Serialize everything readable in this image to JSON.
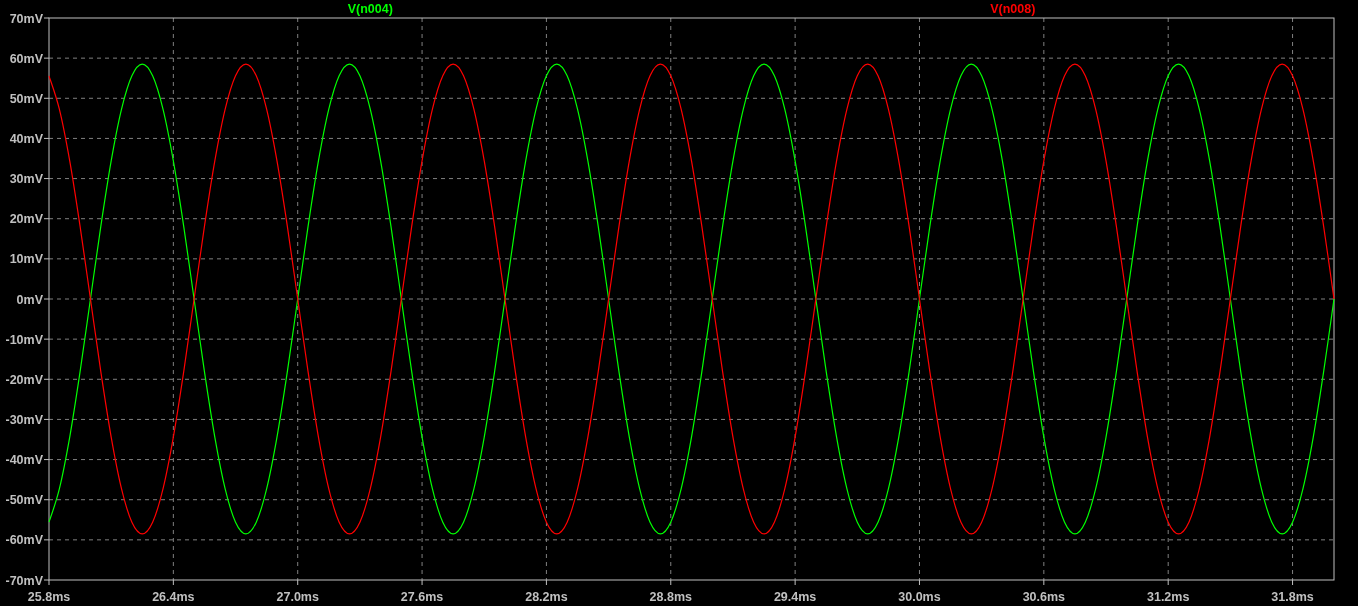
{
  "plot": {
    "chart_data": {
      "type": "line",
      "grid": true,
      "xlim": [
        25.8,
        32.0
      ],
      "ylim": [
        -70,
        70
      ],
      "xticks": [
        {
          "value": 25.8,
          "label": "25.8ms"
        },
        {
          "value": 26.4,
          "label": "26.4ms"
        },
        {
          "value": 27.0,
          "label": "27.0ms"
        },
        {
          "value": 27.6,
          "label": "27.6ms"
        },
        {
          "value": 28.2,
          "label": "28.2ms"
        },
        {
          "value": 28.8,
          "label": "28.8ms"
        },
        {
          "value": 29.4,
          "label": "29.4ms"
        },
        {
          "value": 30.0,
          "label": "30.0ms"
        },
        {
          "value": 30.6,
          "label": "30.6ms"
        },
        {
          "value": 31.2,
          "label": "31.2ms"
        },
        {
          "value": 31.8,
          "label": "31.8ms"
        }
      ],
      "yticks": [
        {
          "value": 70,
          "label": "70mV"
        },
        {
          "value": 60,
          "label": "60mV"
        },
        {
          "value": 50,
          "label": "50mV"
        },
        {
          "value": 40,
          "label": "40mV"
        },
        {
          "value": 30,
          "label": "30mV"
        },
        {
          "value": 20,
          "label": "20mV"
        },
        {
          "value": 10,
          "label": "10mV"
        },
        {
          "value": 0,
          "label": "0mV"
        },
        {
          "value": -10,
          "label": "-10mV"
        },
        {
          "value": -20,
          "label": "-20mV"
        },
        {
          "value": -30,
          "label": "-30mV"
        },
        {
          "value": -40,
          "label": "-40mV"
        },
        {
          "value": -50,
          "label": "-50mV"
        },
        {
          "value": -60,
          "label": "-60mV"
        },
        {
          "value": -70,
          "label": "-70mV"
        }
      ],
      "x": [
        25.8,
        25.85,
        25.9,
        25.95,
        26,
        26.05,
        26.1,
        26.15,
        26.2,
        26.25,
        26.3,
        26.35,
        26.4,
        26.45,
        26.5,
        26.55,
        26.6,
        26.65,
        26.7,
        26.75,
        26.8,
        26.85,
        26.9,
        26.95,
        27,
        27.05,
        27.1,
        27.15,
        27.2,
        27.25,
        27.3,
        27.35,
        27.4,
        27.45,
        27.5,
        27.55,
        27.6,
        27.65,
        27.7,
        27.75,
        27.8,
        27.85,
        27.9,
        27.95,
        28,
        28.05,
        28.1,
        28.15,
        28.2,
        28.25,
        28.3,
        28.35,
        28.4,
        28.45,
        28.5,
        28.55,
        28.6,
        28.65,
        28.7,
        28.75,
        28.8,
        28.85,
        28.9,
        28.95,
        29,
        29.05,
        29.1,
        29.15,
        29.2,
        29.25,
        29.3,
        29.35,
        29.4,
        29.45,
        29.5,
        29.55,
        29.6,
        29.65,
        29.7,
        29.75,
        29.8,
        29.85,
        29.9,
        29.95,
        30,
        30.05,
        30.1,
        30.15,
        30.2,
        30.25,
        30.3,
        30.35,
        30.4,
        30.45,
        30.5,
        30.55,
        30.6,
        30.65,
        30.7,
        30.75,
        30.8,
        30.85,
        30.9,
        30.95,
        31,
        31.05,
        31.1,
        31.15,
        31.2,
        31.25,
        31.3,
        31.35,
        31.4,
        31.45,
        31.5,
        31.55,
        31.6,
        31.65,
        31.7,
        31.75,
        31.8,
        31.85,
        31.9,
        31.95,
        32
      ],
      "series": [
        {
          "name": "V(n004)",
          "color": "#00ff00",
          "values": [
            -55.6,
            -47.3,
            -34.4,
            -18.1,
            0,
            18.1,
            34.4,
            47.3,
            55.6,
            58.5,
            55.6,
            47.3,
            34.4,
            18.1,
            0,
            -18.1,
            -34.4,
            -47.3,
            -55.6,
            -58.5,
            -55.6,
            -47.3,
            -34.4,
            -18.1,
            0,
            18.1,
            34.4,
            47.3,
            55.6,
            58.5,
            55.6,
            47.3,
            34.4,
            18.1,
            0,
            -18.1,
            -34.4,
            -47.3,
            -55.6,
            -58.5,
            -55.6,
            -47.3,
            -34.4,
            -18.1,
            0,
            18.1,
            34.4,
            47.3,
            55.6,
            58.5,
            55.6,
            47.3,
            34.4,
            18.1,
            0,
            -18.1,
            -34.4,
            -47.3,
            -55.6,
            -58.5,
            -55.6,
            -47.3,
            -34.4,
            -18.1,
            0,
            18.1,
            34.4,
            47.3,
            55.6,
            58.5,
            55.6,
            47.3,
            34.4,
            18.1,
            0,
            -18.1,
            -34.4,
            -47.3,
            -55.6,
            -58.5,
            -55.6,
            -47.3,
            -34.4,
            -18.1,
            0,
            18.1,
            34.4,
            47.3,
            55.6,
            58.5,
            55.6,
            47.3,
            34.4,
            18.1,
            0,
            -18.1,
            -34.4,
            -47.3,
            -55.6,
            -58.5,
            -55.6,
            -47.3,
            -34.4,
            -18.1,
            0,
            18.1,
            34.4,
            47.3,
            55.6,
            58.5,
            55.6,
            47.3,
            34.4,
            18.1,
            0,
            -18.1,
            -34.4,
            -47.3,
            -55.6,
            -58.5,
            -55.6,
            -47.3,
            -34.4,
            -18.1,
            0
          ]
        },
        {
          "name": "V(n008)",
          "color": "#ff0000",
          "values": [
            55.6,
            47.3,
            34.4,
            18.1,
            0,
            -18.1,
            -34.4,
            -47.3,
            -55.6,
            -58.5,
            -55.6,
            -47.3,
            -34.4,
            -18.1,
            0,
            18.1,
            34.4,
            47.3,
            55.6,
            58.5,
            55.6,
            47.3,
            34.4,
            18.1,
            0,
            -18.1,
            -34.4,
            -47.3,
            -55.6,
            -58.5,
            -55.6,
            -47.3,
            -34.4,
            -18.1,
            0,
            18.1,
            34.4,
            47.3,
            55.6,
            58.5,
            55.6,
            47.3,
            34.4,
            18.1,
            0,
            -18.1,
            -34.4,
            -47.3,
            -55.6,
            -58.5,
            -55.6,
            -47.3,
            -34.4,
            -18.1,
            0,
            18.1,
            34.4,
            47.3,
            55.6,
            58.5,
            55.6,
            47.3,
            34.4,
            18.1,
            0,
            -18.1,
            -34.4,
            -47.3,
            -55.6,
            -58.5,
            -55.6,
            -47.3,
            -34.4,
            -18.1,
            0,
            18.1,
            34.4,
            47.3,
            55.6,
            58.5,
            55.6,
            47.3,
            34.4,
            18.1,
            0,
            -18.1,
            -34.4,
            -47.3,
            -55.6,
            -58.5,
            -55.6,
            -47.3,
            -34.4,
            -18.1,
            0,
            18.1,
            34.4,
            47.3,
            55.6,
            58.5,
            55.6,
            47.3,
            34.4,
            18.1,
            0,
            -18.1,
            -34.4,
            -47.3,
            -55.6,
            -58.5,
            -55.6,
            -47.3,
            -34.4,
            -18.1,
            0,
            18.1,
            34.4,
            47.3,
            55.6,
            58.5,
            55.6,
            47.3,
            34.4,
            18.1,
            0
          ]
        }
      ]
    }
  }
}
